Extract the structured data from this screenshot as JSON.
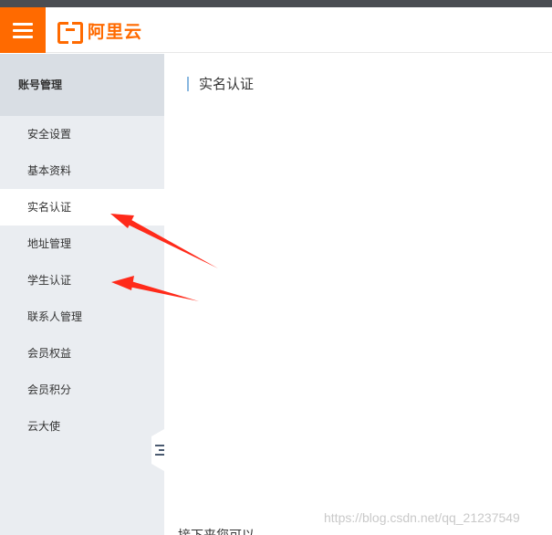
{
  "header": {
    "logo_text": "阿里云",
    "brand_color": "#ff6a00",
    "menu_icon": "hamburger-menu-icon"
  },
  "sidebar": {
    "title": "账号管理",
    "items": [
      {
        "label": "安全设置",
        "active": false
      },
      {
        "label": "基本资料",
        "active": false
      },
      {
        "label": "实名认证",
        "active": true
      },
      {
        "label": "地址管理",
        "active": false
      },
      {
        "label": "学生认证",
        "active": false
      },
      {
        "label": "联系人管理",
        "active": false
      },
      {
        "label": "会员权益",
        "active": false
      },
      {
        "label": "会员积分",
        "active": false
      },
      {
        "label": "云大使",
        "active": false
      }
    ],
    "collapse_icon": "collapse-sidebar-icon"
  },
  "main": {
    "title": "实名认证",
    "footer_text": "接下来您可以"
  },
  "watermark": "https://blog.csdn.net/qq_21237549",
  "annotations": {
    "arrow_color": "#ff2a1a"
  }
}
